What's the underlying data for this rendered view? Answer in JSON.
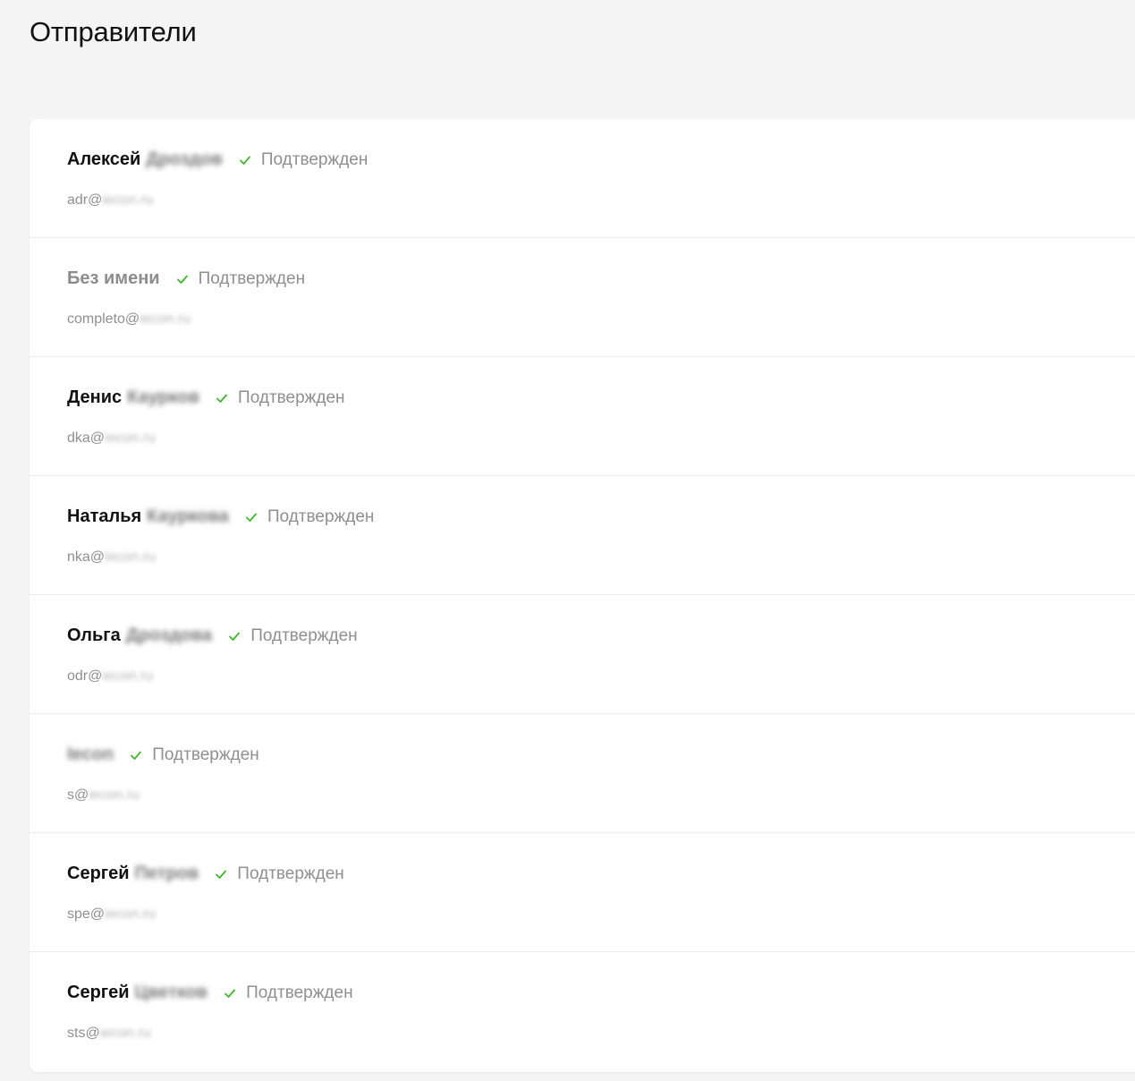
{
  "page": {
    "title": "Отправители"
  },
  "icons": {
    "verified": "check-icon",
    "verified_color": "#3fb62b"
  },
  "senders": [
    {
      "first_name": "Алексей",
      "last_name_hidden": "Дроздов",
      "status": "Подтвержден",
      "email_local": "adr@",
      "email_domain_hidden": "iecon.ru"
    },
    {
      "first_name": "Без имени",
      "last_name_hidden": "",
      "status": "Подтвержден",
      "email_local": "completo@",
      "email_domain_hidden": "iecon.ru"
    },
    {
      "first_name": "Денис",
      "last_name_hidden": "Каурков",
      "status": "Подтвержден",
      "email_local": "dka@",
      "email_domain_hidden": "iecon.ru"
    },
    {
      "first_name": "Наталья",
      "last_name_hidden": "Кауркова",
      "status": "Подтвержден",
      "email_local": "nka@",
      "email_domain_hidden": "iecon.ru"
    },
    {
      "first_name": "Ольга",
      "last_name_hidden": "Дроздова",
      "status": "Подтвержден",
      "email_local": "odr@",
      "email_domain_hidden": "iecon.ru"
    },
    {
      "first_name": "",
      "last_name_hidden": "Iecon",
      "status": "Подтвержден",
      "email_local": "s@",
      "email_domain_hidden": "iecon.ru"
    },
    {
      "first_name": "Сергей",
      "last_name_hidden": "Петров",
      "status": "Подтвержден",
      "email_local": "spe@",
      "email_domain_hidden": "iecon.ru"
    },
    {
      "first_name": "Сергей",
      "last_name_hidden": "Цветков",
      "status": "Подтвержден",
      "email_local": "sts@",
      "email_domain_hidden": "iecon.ru"
    }
  ]
}
